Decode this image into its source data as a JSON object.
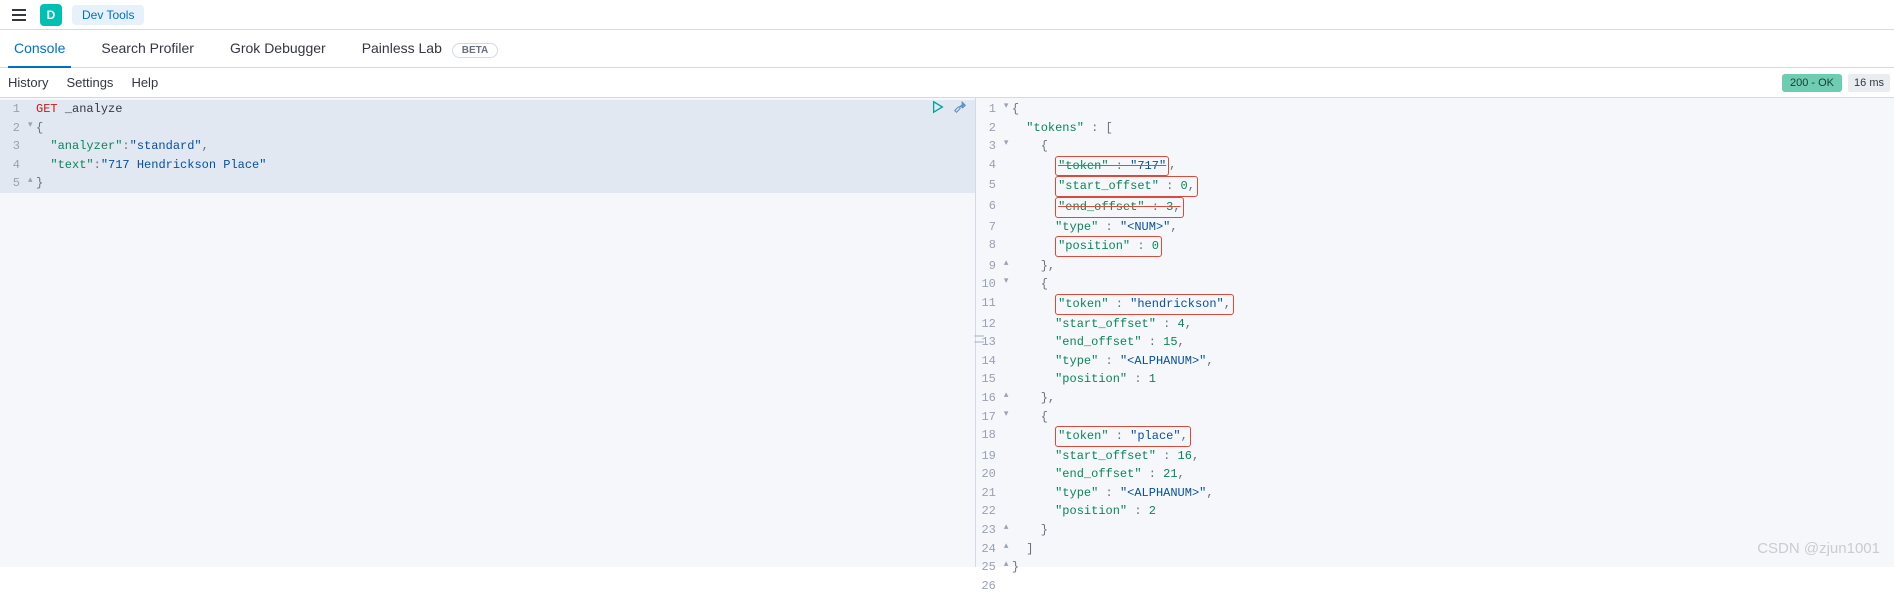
{
  "header": {
    "app_badge": "D",
    "breadcrumb": "Dev Tools"
  },
  "tabs": {
    "console": "Console",
    "search_profiler": "Search Profiler",
    "grok_debugger": "Grok Debugger",
    "painless_lab": "Painless Lab",
    "beta": "BETA"
  },
  "toolbar": {
    "history": "History",
    "settings": "Settings",
    "help": "Help"
  },
  "status": {
    "code": "200 - OK",
    "timing": "16 ms"
  },
  "request": {
    "lines": [
      "1",
      "2",
      "3",
      "4",
      "5"
    ],
    "method": "GET",
    "path": "_analyze",
    "body_open": "{",
    "l3_key": "\"analyzer\"",
    "l3_val": "\"standard\"",
    "l4_key": "\"text\"",
    "l4_val": "\"717 Hendrickson Place\"",
    "body_close": "}"
  },
  "response": {
    "lines": [
      "1",
      "2",
      "3",
      "4",
      "5",
      "6",
      "7",
      "8",
      "9",
      "10",
      "11",
      "12",
      "13",
      "14",
      "15",
      "16",
      "17",
      "18",
      "19",
      "20",
      "21",
      "22",
      "23",
      "24",
      "25",
      "26"
    ],
    "open": "{",
    "tokens_key": "\"tokens\"",
    "arr_open": "[",
    "obj_open": "{",
    "t1_token_key": "\"token\"",
    "t1_token_val": "\"717\"",
    "t1_so_key": "\"start_offset\"",
    "t1_so_val": "0",
    "t1_eo_key": "\"end_offset\"",
    "t1_eo_val": "3",
    "t1_type_key": "\"type\"",
    "t1_type_val": "\"<NUM>\"",
    "t1_pos_key": "\"position\"",
    "t1_pos_val": "0",
    "obj_close_comma": "},",
    "t2_token_key": "\"token\"",
    "t2_token_val": "\"hendrickson\"",
    "t2_so_key": "\"start_offset\"",
    "t2_so_val": "4",
    "t2_eo_key": "\"end_offset\"",
    "t2_eo_val": "15",
    "t2_type_key": "\"type\"",
    "t2_type_val": "\"<ALPHANUM>\"",
    "t2_pos_key": "\"position\"",
    "t2_pos_val": "1",
    "t3_token_key": "\"token\"",
    "t3_token_val": "\"place\"",
    "t3_so_key": "\"start_offset\"",
    "t3_so_val": "16",
    "t3_eo_key": "\"end_offset\"",
    "t3_eo_val": "21",
    "t3_type_key": "\"type\"",
    "t3_type_val": "\"<ALPHANUM>\"",
    "t3_pos_key": "\"position\"",
    "t3_pos_val": "2",
    "obj_close": "}",
    "arr_close": "]",
    "close": "}"
  },
  "watermark": "CSDN @zjun1001"
}
